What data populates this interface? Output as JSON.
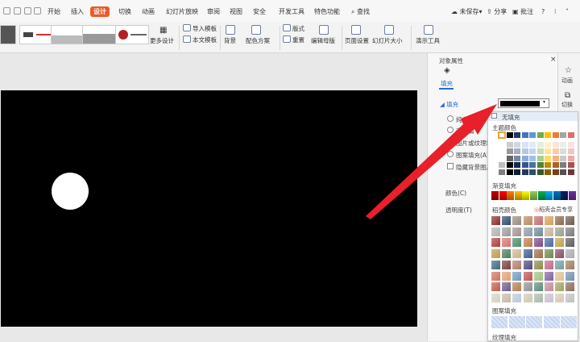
{
  "menubar": {
    "tabs": [
      "开始",
      "插入",
      "设计",
      "切换",
      "动画",
      "幻灯片放映",
      "审阅",
      "视图",
      "安全",
      "开发工具",
      "特色功能"
    ],
    "active_tab": "设计",
    "search_label": "查找",
    "unsaved_label": "未保存",
    "share_label": "分享",
    "comment_label": "批注",
    "help_label": "?",
    "accent_color": "#e85c2c"
  },
  "ribbon": {
    "more_design": "更多设计",
    "import_template": "导入模板",
    "this_template": "本文模板",
    "background": "背景",
    "color_scheme": "配色方案",
    "layout": "版式",
    "reset": "重置",
    "edit_master": "编辑母版",
    "page_setup": "页面设置",
    "slide_size": "幻灯片大小",
    "presentation_tools": "演示工具"
  },
  "panel": {
    "title": "对象属性",
    "fill_tab": "填充",
    "fill_section": "填充",
    "solid_fill": "纯色填",
    "gradient_fill": "渐变填",
    "picture_fill": "图片或纹理填",
    "pattern_fill": "图案填充(A)",
    "hide_bg": "隐藏背景图片",
    "color_label": "颜色(C)",
    "transparency_label": "透明度(T)",
    "current_color": "#000000"
  },
  "sidebar": {
    "animation": "动画",
    "switch": "切换"
  },
  "popup": {
    "no_fill": "无填充",
    "theme_colors": "主题颜色",
    "gradient_fill": "渐变填充",
    "shell_colors": "稻壳颜色",
    "member_exclusive": "稻壳会员专享",
    "pattern_fill": "图案填充",
    "texture_fill": "纹理填充"
  },
  "colors": {
    "theme_row": [
      "#ffffff",
      "#000000",
      "#1f3864",
      "#4472c4",
      "#5b9bd5",
      "#70ad47",
      "#ffc000",
      "#ed7d31",
      "#a5a5a5",
      "#e46c6c"
    ],
    "gradient_row": [
      "#c00000",
      "#ff0000",
      "#ff7f00",
      "#ffc000",
      "#ffff00",
      "#92d050",
      "#00b050",
      "#00b0f0",
      "#0070c0",
      "#002060",
      "#7030a0"
    ],
    "arrow": "#e8202a"
  }
}
